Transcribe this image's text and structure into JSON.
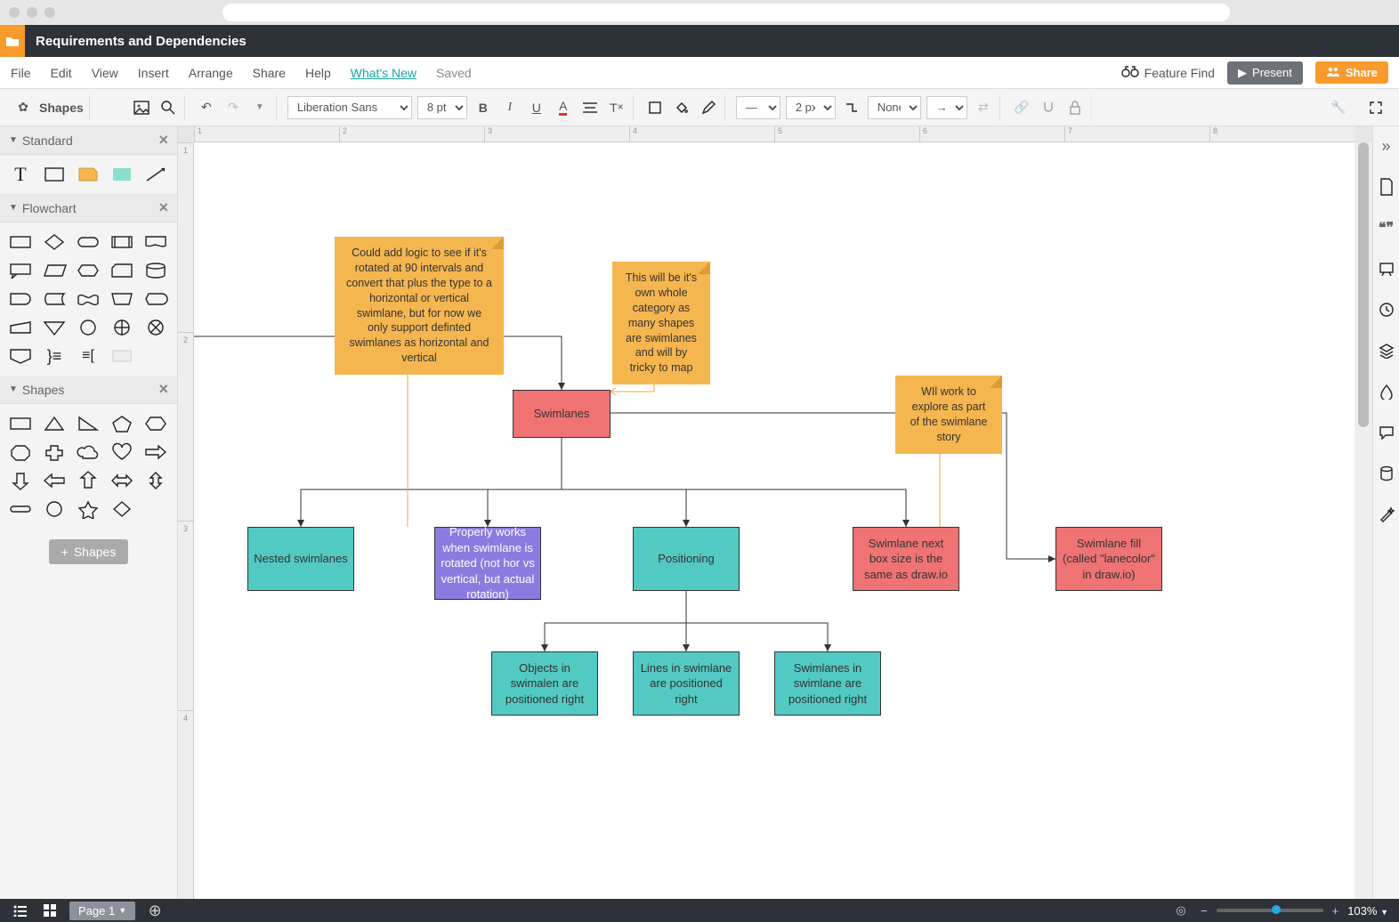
{
  "document": {
    "title": "Requirements and Dependencies"
  },
  "menu": {
    "items": [
      "File",
      "Edit",
      "View",
      "Insert",
      "Arrange",
      "Share",
      "Help"
    ],
    "whats_new": "What's New",
    "saved": "Saved",
    "feature_find": "Feature Find",
    "present": "Present",
    "share": "Share"
  },
  "toolbar": {
    "shapes_label": "Shapes",
    "font_family": "Liberation Sans",
    "font_size": "8 pt",
    "line_style": "—",
    "line_width": "2 px",
    "line_fill": "None"
  },
  "left_panel": {
    "sections": [
      "Standard",
      "Flowchart",
      "Shapes"
    ],
    "shapes_button": "Shapes"
  },
  "ruler": {
    "h": [
      "1",
      "2",
      "3",
      "4",
      "5",
      "6",
      "7",
      "8"
    ],
    "v": [
      "1",
      "2",
      "3",
      "4"
    ]
  },
  "canvas": {
    "notes": {
      "n1": "Could add logic to see if it's rotated at 90 intervals and convert that plus the type to a horizontal or vertical swimlane, but for now we only support definted swimlanes as horizontal and vertical",
      "n2": "This will be it's own whole category as many shapes are swimlanes and will by tricky to map",
      "n3": "WIl work to explore as part of the swimlane story"
    },
    "nodes": {
      "swimlanes": "Swimlanes",
      "nested": "Nested swimlanes",
      "rotated": "Properly works when swimlane is rotated (not hor vs vertical, but actual rotation)",
      "positioning": "Positioning",
      "boxsize": "Swimlane next box size is the same as draw.io",
      "fill": "Swimlane fill (called \"lanecolor\" in draw.io)",
      "objright": "Objects in swimalen are positioned right",
      "linesright": "Lines in swimlane are positioned right",
      "swimright": "Swimlanes in swimlane are positioned right"
    }
  },
  "statusbar": {
    "page_label": "Page 1",
    "zoom": "103%"
  }
}
